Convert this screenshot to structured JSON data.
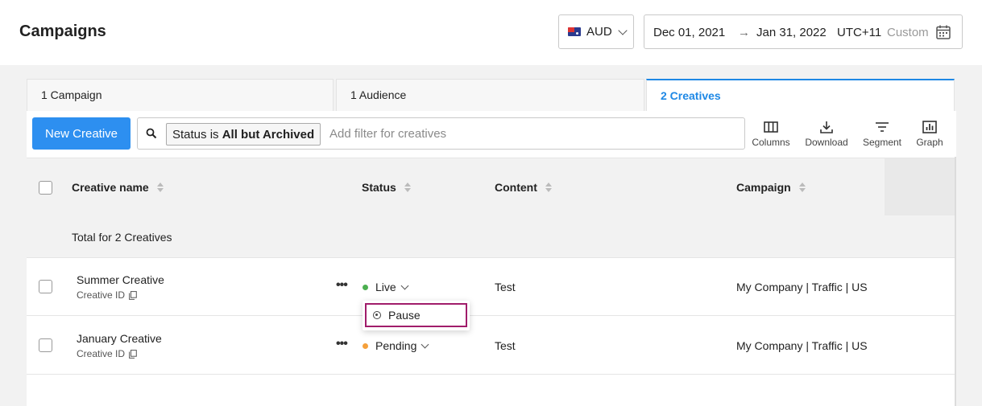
{
  "header": {
    "title": "Campaigns",
    "currency": "AUD",
    "date_start": "Dec 01, 2021",
    "date_arrow": "→",
    "date_end": "Jan 31, 2022",
    "timezone": "UTC+11",
    "range_label": "Custom"
  },
  "tabs": [
    {
      "label": "1 Campaign",
      "active": false
    },
    {
      "label": "1 Audience",
      "active": false
    },
    {
      "label": "2 Creatives",
      "active": true
    }
  ],
  "toolbar": {
    "new_button": "New Creative",
    "filter_chip_prefix": "Status is ",
    "filter_chip_value": "All but Archived",
    "filter_placeholder": "Add filter for creatives",
    "tools": [
      "Columns",
      "Download",
      "Segment",
      "Graph"
    ]
  },
  "table": {
    "columns": [
      "Creative name",
      "Status",
      "Content",
      "Campaign"
    ],
    "total_label": "Total for 2 Creatives",
    "rows": [
      {
        "name": "Summer Creative",
        "id_label": "Creative ID",
        "status": "Live",
        "status_color": "#4caf50",
        "content": "Test",
        "campaign": "My Company | Traffic | US"
      },
      {
        "name": "January Creative",
        "id_label": "Creative ID",
        "status": "Pending",
        "status_color": "#f5a03b",
        "content": "Test",
        "campaign": "My Company | Traffic | US"
      }
    ]
  },
  "status_menu": {
    "items": [
      "Pause"
    ],
    "highlight_color": "#a01c6a"
  },
  "colors": {
    "accent": "#2d8ff0",
    "tab_active": "#1e88e5"
  }
}
